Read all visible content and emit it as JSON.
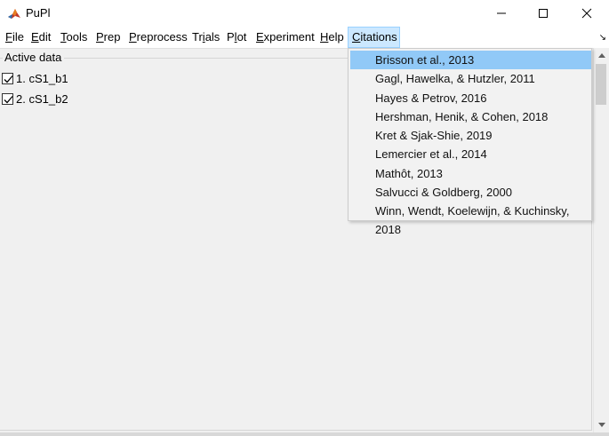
{
  "window": {
    "title": "PuPl",
    "minimize_symbol": "—",
    "maximize_symbol": "☐",
    "close_symbol": "✕"
  },
  "menu": {
    "items": [
      {
        "mnemonic": "F",
        "rest": "ile"
      },
      {
        "mnemonic": "E",
        "rest": "dit"
      },
      {
        "mnemonic": "T",
        "rest": "ools"
      },
      {
        "mnemonic": "P",
        "rest": "rep"
      },
      {
        "mnemonic": "P",
        "rest": "reprocess"
      },
      {
        "pre": "Tr",
        "mnemonic": "i",
        "rest": "als"
      },
      {
        "pre": "P",
        "mnemonic": "l",
        "rest": "ot"
      },
      {
        "mnemonic": "E",
        "rest": "xperiment"
      },
      {
        "mnemonic": "H",
        "rest": "elp"
      },
      {
        "mnemonic": "C",
        "rest": "itations"
      }
    ],
    "corner_glyph": "↘"
  },
  "panel": {
    "title": "Active data",
    "items": [
      {
        "label": "1. cS1_b1",
        "checked": true
      },
      {
        "label": "2. cS1_b2",
        "checked": true
      }
    ]
  },
  "citations": {
    "items": [
      "Brisson et al., 2013",
      "Gagl, Hawelka, & Hutzler, 2011",
      "Hayes & Petrov, 2016",
      "Hershman, Henik, & Cohen, 2018",
      "Kret & Sjak-Shie, 2019",
      "Lemercier et al., 2014",
      "Mathôt, 2013",
      "Salvucci & Goldberg, 2000",
      "Winn, Wendt, Koelewijn, & Kuchinsky, 2018"
    ],
    "highlighted_index": 0
  },
  "colors": {
    "menu_active_bg": "#cce8ff",
    "dropdown_highlight": "#91c9f7"
  }
}
